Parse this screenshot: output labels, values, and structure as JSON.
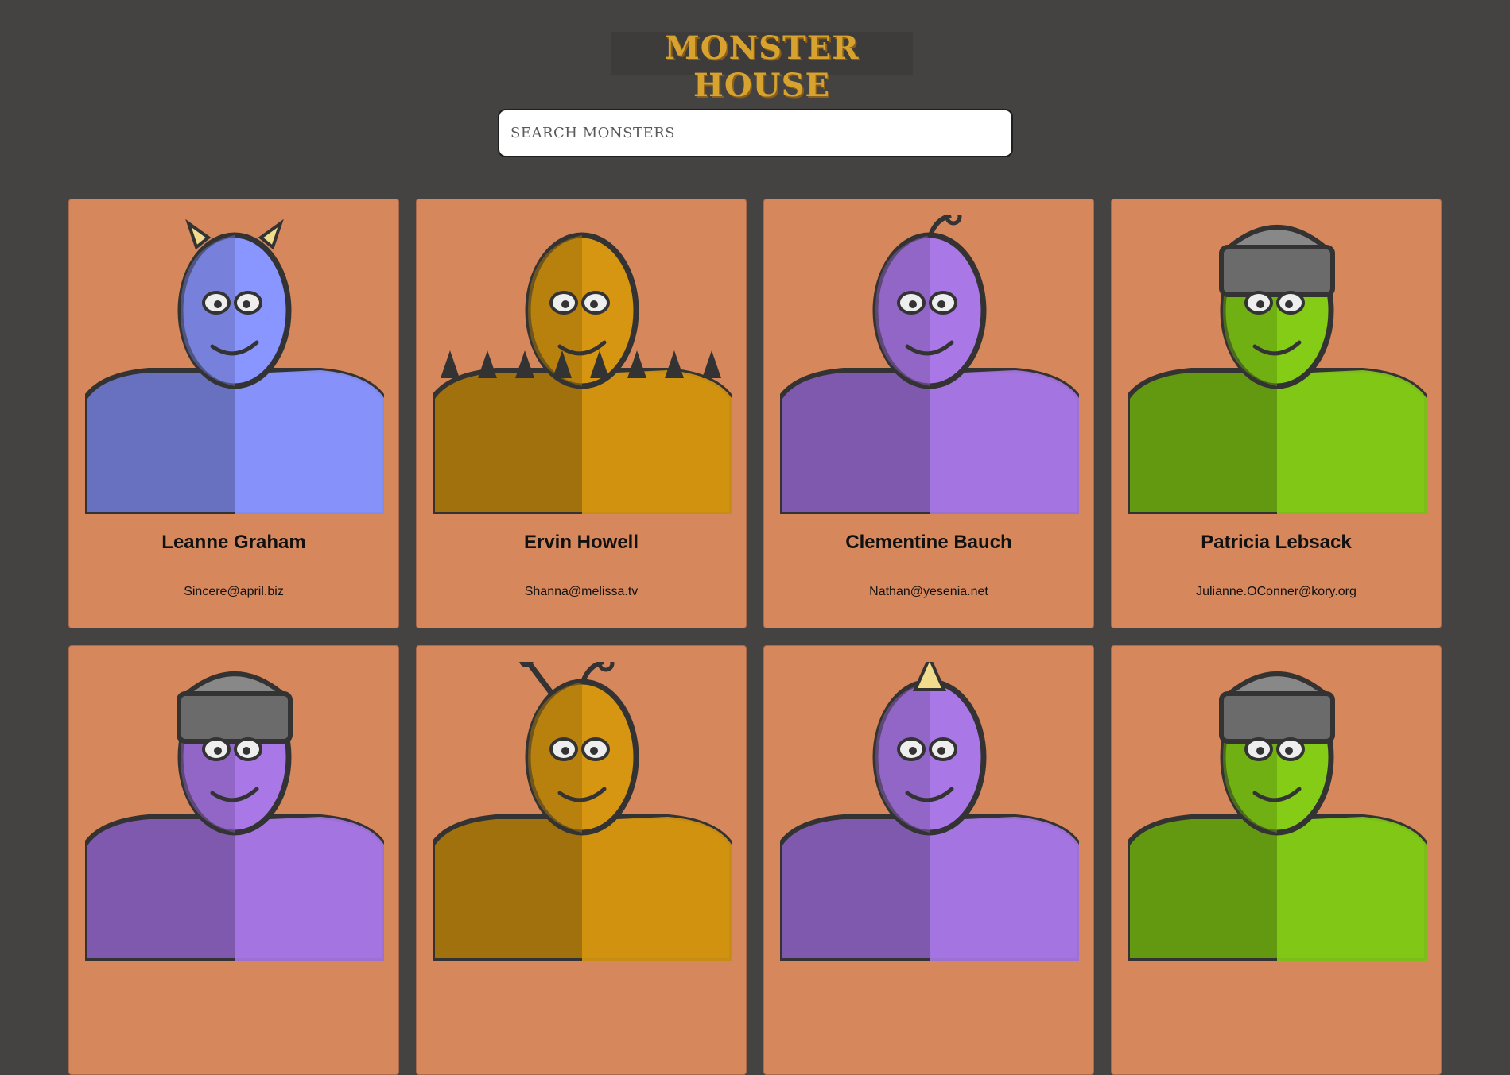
{
  "header": {
    "logo_text": "MONSTER HOUSE"
  },
  "search": {
    "placeholder": "SEARCH MONSTERS"
  },
  "monsters": [
    {
      "name": "Leanne Graham",
      "email": "Sincere@april.biz",
      "color": "#8a96ff",
      "feature": "horns"
    },
    {
      "name": "Ervin Howell",
      "email": "Shanna@melissa.tv",
      "color": "#d69611",
      "feature": "spikes"
    },
    {
      "name": "Clementine Bauch",
      "email": "Nathan@yesenia.net",
      "color": "#a977e6",
      "feature": "antenna"
    },
    {
      "name": "Patricia Lebsack",
      "email": "Julianne.OConner@kory.org",
      "color": "#84cc16",
      "feature": "helmet"
    },
    {
      "name": "",
      "email": "",
      "color": "#a977e6",
      "feature": "helmet"
    },
    {
      "name": "",
      "email": "",
      "color": "#d69611",
      "feature": "stalks"
    },
    {
      "name": "",
      "email": "",
      "color": "#a977e6",
      "feature": "horn"
    },
    {
      "name": "",
      "email": "",
      "color": "#84cc16",
      "feature": "helmet"
    }
  ],
  "colors": {
    "background": "#444342",
    "card": "#d6875c",
    "logo": "#d8a22f"
  }
}
